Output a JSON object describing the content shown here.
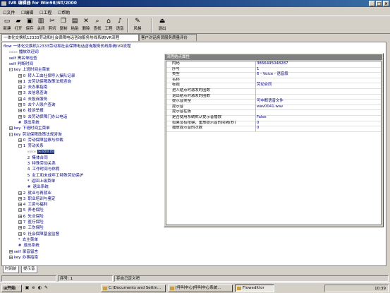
{
  "window": {
    "title": "IVR 编辑器 for Win98/NT/2000"
  },
  "menu": [
    "文件",
    "编辑",
    "工程",
    "帮助"
  ],
  "toolbar": [
    {
      "label": "新建",
      "icon": "new-file-icon",
      "glyph": "▭"
    },
    {
      "label": "打开",
      "icon": "open-folder-icon",
      "glyph": "▰"
    },
    {
      "label": "保存",
      "icon": "save-icon",
      "glyph": "▣"
    },
    {
      "label": "关闭",
      "icon": "close-doc-icon",
      "glyph": "▥"
    },
    {
      "label": "剪切",
      "icon": "cut-icon",
      "glyph": "✂"
    },
    {
      "label": "复制",
      "icon": "copy-icon",
      "glyph": "❐"
    },
    {
      "label": "粘贴",
      "icon": "paste-icon",
      "glyph": "▤"
    },
    {
      "label": "删除",
      "icon": "delete-icon",
      "glyph": "✕"
    },
    {
      "label": "查找",
      "icon": "find-icon",
      "glyph": "⌕"
    },
    {
      "label": "工程",
      "icon": "project-icon",
      "glyph": "⌂"
    },
    {
      "label": "语音",
      "icon": "voice-icon",
      "glyph": "♪"
    },
    {
      "label": "风格",
      "icon": "style-icon",
      "glyph": "✎"
    },
    {
      "label": "退出",
      "icon": "exit-icon",
      "glyph": "⏏"
    }
  ],
  "doc_tabs": [
    {
      "label": "一体化交换机12333劳动和社会保障电话咨询服务热线系统IVR流程",
      "active": true
    },
    {
      "label": "客户对话务员服务质量评价",
      "active": false
    }
  ],
  "tree": [
    {
      "kw": "flow",
      "text": "一体化交换机12333劳动和社会保障电话咨询服务热线系统IVR流程"
    },
    {
      "kw": "voice",
      "text": "播放欢迎词"
    },
    {
      "kw": "self",
      "text": "黑名单检查"
    },
    {
      "kw": "self",
      "text": "判断时间"
    },
    {
      "kw": "key",
      "text": "上班时间主菜单"
    },
    {
      "num": "0",
      "text": "转人工由社保呼入操队记录"
    },
    {
      "num": "1",
      "text": "去劳动保障政策法规咨询"
    },
    {
      "num": "2",
      "text": "去办事指南"
    },
    {
      "num": "3",
      "text": "去信息查询"
    },
    {
      "num": "4",
      "text": "去投诉服务"
    },
    {
      "num": "5",
      "text": "去个人账户查询"
    },
    {
      "num": "6",
      "text": "投诉举报"
    },
    {
      "num": "9",
      "text": "去劳动保障门办公电话"
    },
    {
      "num": "#",
      "text": "退出系统"
    },
    {
      "kw": "key",
      "text": "下班时间主菜单"
    },
    {
      "kw": "key",
      "text": "劳动保障政策法规咨询"
    },
    {
      "num": "0",
      "text": "劳动保障监察与仲裁"
    },
    {
      "num": "1",
      "text": "劳动关系"
    },
    {
      "kw": "voice",
      "text": "劳动合同"
    },
    {
      "num": "2",
      "text": "集体合同"
    },
    {
      "num": "3",
      "text": "特殊劳动关系"
    },
    {
      "num": "4",
      "text": "工作时间与休假"
    },
    {
      "num": "5",
      "text": "女工和未成年工特殊劳动保护"
    },
    {
      "num": "*",
      "text": "返回上级菜单"
    },
    {
      "num": "#",
      "text": "退出系统"
    },
    {
      "num": "2",
      "text": "就业与再就业"
    },
    {
      "num": "3",
      "text": "职业培训与鉴定"
    },
    {
      "num": "4",
      "text": "工资与福利"
    },
    {
      "num": "5",
      "text": "养老保险"
    },
    {
      "num": "6",
      "text": "失业保险"
    },
    {
      "num": "7",
      "text": "医疗保险"
    },
    {
      "num": "8",
      "text": "工伤保险"
    },
    {
      "num": "9",
      "text": "社会保障基金监督"
    },
    {
      "num": "*",
      "text": "去主菜单"
    },
    {
      "num": "#",
      "text": "退出系统"
    },
    {
      "kw": "self",
      "text": "录音留言"
    },
    {
      "kw": "key",
      "text": "办事指南"
    }
  ],
  "props": {
    "title": "流程结点属性",
    "rows": [
      {
        "k": "内码",
        "v": "3866495048287"
      },
      {
        "k": "序号",
        "v": "1"
      },
      {
        "k": "类型",
        "v": " 6 - Voice - 语音段"
      },
      {
        "k": "名称",
        "v": ""
      },
      {
        "k": "标题",
        "v": "劳动合同"
      },
      {
        "k": "进入结点时激发的函数",
        "v": ""
      },
      {
        "k": "退出结点时激发的函数",
        "v": ""
      },
      {
        "k": "提示音类型",
        "v": "可中断语音文件"
      },
      {
        "k": "提示音",
        "v": "wav0041.wav"
      },
      {
        "k": "提示音在板",
        "v": ""
      },
      {
        "k": "是否使用系统默认提示音播放",
        "v": "False"
      },
      {
        "k": "如果没有按键，重放提示音的间隔(秒)",
        "v": "0"
      },
      {
        "k": "播放提示音的次数",
        "v": "0"
      }
    ]
  },
  "bottom_tabs": [
    "时间前",
    "提示音"
  ],
  "status": {
    "left": "",
    "seq": "序号: 1",
    "right": "存自己定义吧"
  },
  "taskbar": {
    "start": "开始",
    "tasks": [
      "C:\\Documents and Settin...",
      "[呼叫中心]呼叫中心系统...",
      "Flowedittor"
    ],
    "clock": "10:39"
  }
}
